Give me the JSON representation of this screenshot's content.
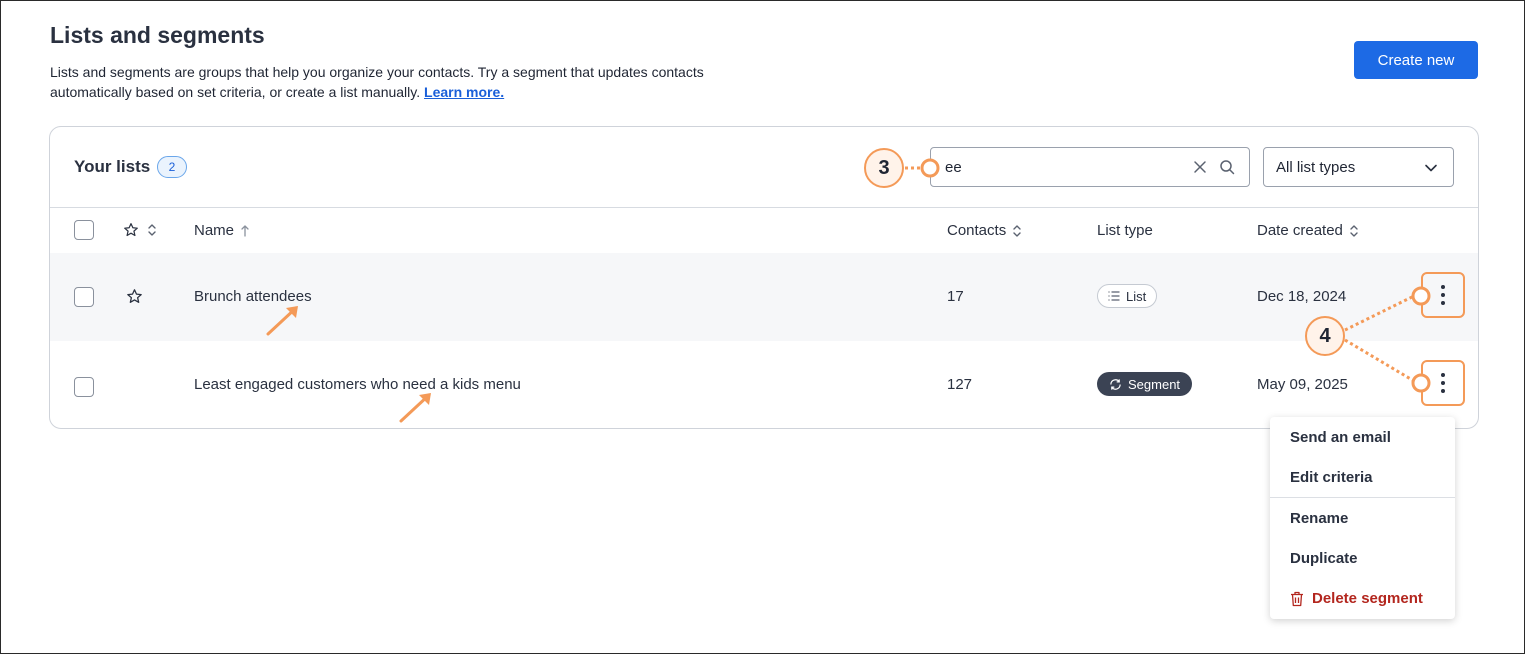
{
  "header": {
    "title": "Lists and segments",
    "description": "Lists and segments are groups that help you organize your contacts. Try a segment that updates contacts automatically based on set criteria, or create a list manually.",
    "learn_more": "Learn more.",
    "create_button": "Create new"
  },
  "card": {
    "title": "Your lists",
    "count": "2",
    "search": {
      "value": "ee"
    },
    "filter": {
      "selected": "All list types"
    },
    "columns": {
      "name": "Name",
      "contacts": "Contacts",
      "list_type": "List type",
      "date_created": "Date created"
    },
    "rows": [
      {
        "name": "Brunch attendees",
        "contacts": "17",
        "type": "List",
        "date": "Dec 18, 2024"
      },
      {
        "name": "Least engaged customers who need a kids menu",
        "contacts": "127",
        "type": "Segment",
        "date": "May 09, 2025"
      }
    ]
  },
  "menu": {
    "items": [
      "Send an email",
      "Edit criteria",
      "Rename",
      "Duplicate"
    ],
    "delete": "Delete segment"
  },
  "callouts": {
    "search": "3",
    "actions": "4"
  },
  "colors": {
    "accent": "#1d6ae5",
    "callout": "#f49a58",
    "danger": "#b3261e",
    "segment_pill": "#3b4354"
  },
  "icons": [
    "search-icon",
    "clear-icon",
    "chevron-down-icon",
    "star-icon",
    "sort-icon",
    "list-icon",
    "refresh-icon",
    "kebab-icon",
    "trash-icon"
  ]
}
